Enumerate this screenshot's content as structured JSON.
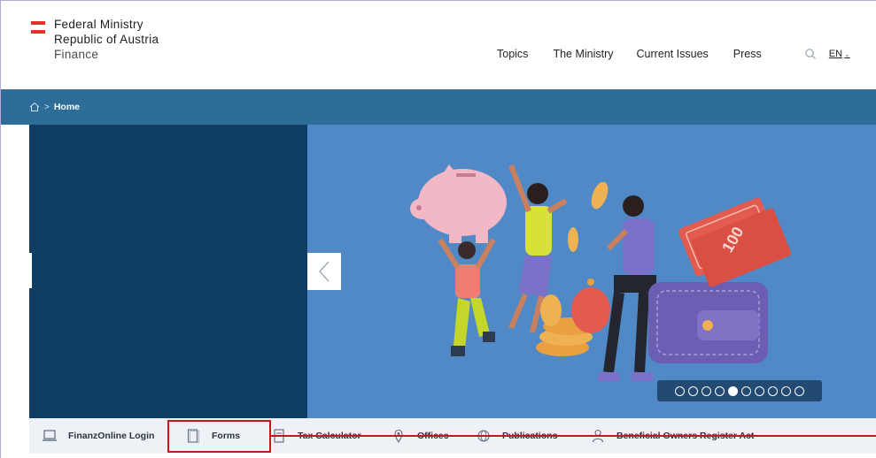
{
  "header": {
    "logo_line1": "Federal Ministry",
    "logo_line2": "Republic of Austria",
    "logo_line3": "Finance",
    "nav": [
      "Topics",
      "The Ministry",
      "Current Issues",
      "Press"
    ],
    "lang": "EN",
    "search_icon": "search-icon"
  },
  "breadcrumb": {
    "home_icon": "home-icon",
    "separator": ">",
    "current": "Home"
  },
  "hero": {
    "banknote_text": "100",
    "slide_count": 10,
    "active_slide": 5
  },
  "quicklinks": [
    {
      "label": "FinanzOnline Login",
      "icon": "laptop-icon"
    },
    {
      "label": "Forms",
      "icon": "document-icon"
    },
    {
      "label": "Tax Calculator",
      "icon": "calculator-icon"
    },
    {
      "label": "Offices",
      "icon": "location-icon"
    },
    {
      "label": "Publications",
      "icon": "globe-icon"
    },
    {
      "label": "Beneficial Owners Register Act",
      "icon": "person-icon"
    }
  ],
  "colors": {
    "header_bar": "#2f6d99",
    "hero_dark": "#0f3c62",
    "hero_bg": "#5189c6",
    "annotation": "#c4161c",
    "flag_red": "#e5302d"
  }
}
